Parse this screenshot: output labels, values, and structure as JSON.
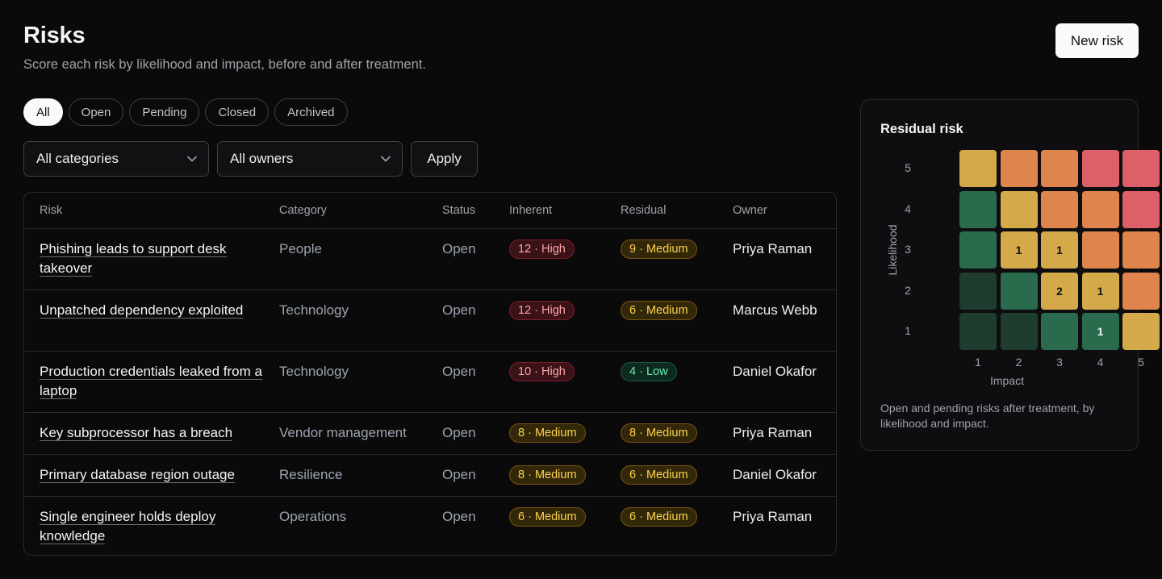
{
  "header": {
    "title": "Risks",
    "subtitle": "Score each risk by likelihood and impact, before and after treatment.",
    "new_button": "New risk"
  },
  "tabs": [
    {
      "label": "All",
      "active": true
    },
    {
      "label": "Open",
      "active": false
    },
    {
      "label": "Pending",
      "active": false
    },
    {
      "label": "Closed",
      "active": false
    },
    {
      "label": "Archived",
      "active": false
    }
  ],
  "filters": {
    "category": "All categories",
    "owner": "All owners",
    "apply_label": "Apply"
  },
  "table": {
    "columns": [
      "Risk",
      "Category",
      "Status",
      "Inherent",
      "Residual",
      "Owner"
    ],
    "rows": [
      {
        "risk": "Phishing leads to support desk takeover",
        "category": "People",
        "status": "Open",
        "inherent": "12 · High",
        "inherent_level": "high",
        "residual": "9 · Medium",
        "residual_level": "medium",
        "owner": "Priya Raman"
      },
      {
        "risk": "Unpatched dependency exploited",
        "category": "Technology",
        "status": "Open",
        "inherent": "12 · High",
        "inherent_level": "high",
        "residual": "6 · Medium",
        "residual_level": "medium",
        "owner": "Marcus Webb"
      },
      {
        "risk": "Production credentials leaked from a laptop",
        "category": "Technology",
        "status": "Open",
        "inherent": "10 · High",
        "inherent_level": "high",
        "residual": "4 · Low",
        "residual_level": "low",
        "owner": "Daniel Okafor"
      },
      {
        "risk": "Key subprocessor has a breach",
        "category": "Vendor management",
        "status": "Open",
        "inherent": "8 · Medium",
        "inherent_level": "medium",
        "residual": "8 · Medium",
        "residual_level": "medium",
        "owner": "Priya Raman"
      },
      {
        "risk": "Primary database region outage",
        "category": "Resilience",
        "status": "Open",
        "inherent": "8 · Medium",
        "inherent_level": "medium",
        "residual": "6 · Medium",
        "residual_level": "medium",
        "owner": "Daniel Okafor"
      },
      {
        "risk": "Single engineer holds deploy knowledge",
        "category": "Operations",
        "status": "Open",
        "inherent": "6 · Medium",
        "inherent_level": "medium",
        "residual": "6 · Medium",
        "residual_level": "medium",
        "owner": "Priya Raman"
      }
    ]
  },
  "matrix": {
    "title": "Residual risk",
    "y_label": "Likelihood",
    "x_label": "Impact",
    "y_ticks": [
      "5",
      "4",
      "3",
      "2",
      "1"
    ],
    "x_ticks": [
      "1",
      "2",
      "3",
      "4",
      "5"
    ],
    "caption": "Open and pending risks after treatment, by likelihood and impact.",
    "colors": {
      "g1": "#1e3d2f",
      "g2": "#2a6b4e",
      "y": "#d4a94a",
      "o": "#df844c",
      "r": "#dd5f68"
    },
    "cells": [
      [
        {
          "c": "y",
          "v": ""
        },
        {
          "c": "o",
          "v": ""
        },
        {
          "c": "o",
          "v": ""
        },
        {
          "c": "r",
          "v": ""
        },
        {
          "c": "r",
          "v": ""
        }
      ],
      [
        {
          "c": "g2",
          "v": ""
        },
        {
          "c": "y",
          "v": ""
        },
        {
          "c": "o",
          "v": ""
        },
        {
          "c": "o",
          "v": ""
        },
        {
          "c": "r",
          "v": ""
        }
      ],
      [
        {
          "c": "g2",
          "v": ""
        },
        {
          "c": "y",
          "v": "1"
        },
        {
          "c": "y",
          "v": "1"
        },
        {
          "c": "o",
          "v": ""
        },
        {
          "c": "o",
          "v": ""
        }
      ],
      [
        {
          "c": "g1",
          "v": ""
        },
        {
          "c": "g2",
          "v": ""
        },
        {
          "c": "y",
          "v": "2"
        },
        {
          "c": "y",
          "v": "1"
        },
        {
          "c": "o",
          "v": ""
        }
      ],
      [
        {
          "c": "g1",
          "v": ""
        },
        {
          "c": "g1",
          "v": ""
        },
        {
          "c": "g2",
          "v": ""
        },
        {
          "c": "g2",
          "v": "1"
        },
        {
          "c": "y",
          "v": ""
        }
      ]
    ]
  }
}
